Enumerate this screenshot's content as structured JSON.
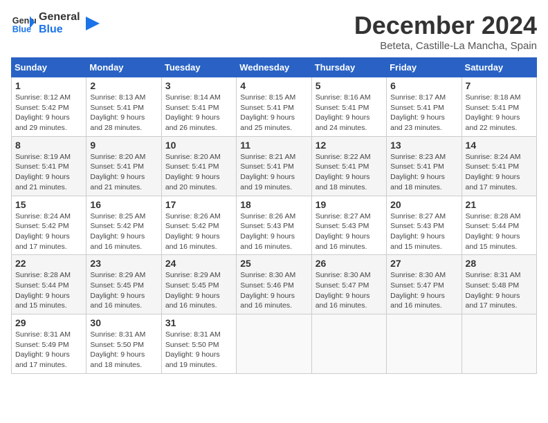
{
  "logo": {
    "line1": "General",
    "line2": "Blue"
  },
  "title": "December 2024",
  "subtitle": "Beteta, Castille-La Mancha, Spain",
  "weekdays": [
    "Sunday",
    "Monday",
    "Tuesday",
    "Wednesday",
    "Thursday",
    "Friday",
    "Saturday"
  ],
  "weeks": [
    [
      {
        "day": "1",
        "sunrise": "8:12 AM",
        "sunset": "5:42 PM",
        "daylight": "9 hours and 29 minutes."
      },
      {
        "day": "2",
        "sunrise": "8:13 AM",
        "sunset": "5:41 PM",
        "daylight": "9 hours and 28 minutes."
      },
      {
        "day": "3",
        "sunrise": "8:14 AM",
        "sunset": "5:41 PM",
        "daylight": "9 hours and 26 minutes."
      },
      {
        "day": "4",
        "sunrise": "8:15 AM",
        "sunset": "5:41 PM",
        "daylight": "9 hours and 25 minutes."
      },
      {
        "day": "5",
        "sunrise": "8:16 AM",
        "sunset": "5:41 PM",
        "daylight": "9 hours and 24 minutes."
      },
      {
        "day": "6",
        "sunrise": "8:17 AM",
        "sunset": "5:41 PM",
        "daylight": "9 hours and 23 minutes."
      },
      {
        "day": "7",
        "sunrise": "8:18 AM",
        "sunset": "5:41 PM",
        "daylight": "9 hours and 22 minutes."
      }
    ],
    [
      {
        "day": "8",
        "sunrise": "8:19 AM",
        "sunset": "5:41 PM",
        "daylight": "9 hours and 21 minutes."
      },
      {
        "day": "9",
        "sunrise": "8:20 AM",
        "sunset": "5:41 PM",
        "daylight": "9 hours and 21 minutes."
      },
      {
        "day": "10",
        "sunrise": "8:20 AM",
        "sunset": "5:41 PM",
        "daylight": "9 hours and 20 minutes."
      },
      {
        "day": "11",
        "sunrise": "8:21 AM",
        "sunset": "5:41 PM",
        "daylight": "9 hours and 19 minutes."
      },
      {
        "day": "12",
        "sunrise": "8:22 AM",
        "sunset": "5:41 PM",
        "daylight": "9 hours and 18 minutes."
      },
      {
        "day": "13",
        "sunrise": "8:23 AM",
        "sunset": "5:41 PM",
        "daylight": "9 hours and 18 minutes."
      },
      {
        "day": "14",
        "sunrise": "8:24 AM",
        "sunset": "5:41 PM",
        "daylight": "9 hours and 17 minutes."
      }
    ],
    [
      {
        "day": "15",
        "sunrise": "8:24 AM",
        "sunset": "5:42 PM",
        "daylight": "9 hours and 17 minutes."
      },
      {
        "day": "16",
        "sunrise": "8:25 AM",
        "sunset": "5:42 PM",
        "daylight": "9 hours and 16 minutes."
      },
      {
        "day": "17",
        "sunrise": "8:26 AM",
        "sunset": "5:42 PM",
        "daylight": "9 hours and 16 minutes."
      },
      {
        "day": "18",
        "sunrise": "8:26 AM",
        "sunset": "5:43 PM",
        "daylight": "9 hours and 16 minutes."
      },
      {
        "day": "19",
        "sunrise": "8:27 AM",
        "sunset": "5:43 PM",
        "daylight": "9 hours and 16 minutes."
      },
      {
        "day": "20",
        "sunrise": "8:27 AM",
        "sunset": "5:43 PM",
        "daylight": "9 hours and 15 minutes."
      },
      {
        "day": "21",
        "sunrise": "8:28 AM",
        "sunset": "5:44 PM",
        "daylight": "9 hours and 15 minutes."
      }
    ],
    [
      {
        "day": "22",
        "sunrise": "8:28 AM",
        "sunset": "5:44 PM",
        "daylight": "9 hours and 15 minutes."
      },
      {
        "day": "23",
        "sunrise": "8:29 AM",
        "sunset": "5:45 PM",
        "daylight": "9 hours and 16 minutes."
      },
      {
        "day": "24",
        "sunrise": "8:29 AM",
        "sunset": "5:45 PM",
        "daylight": "9 hours and 16 minutes."
      },
      {
        "day": "25",
        "sunrise": "8:30 AM",
        "sunset": "5:46 PM",
        "daylight": "9 hours and 16 minutes."
      },
      {
        "day": "26",
        "sunrise": "8:30 AM",
        "sunset": "5:47 PM",
        "daylight": "9 hours and 16 minutes."
      },
      {
        "day": "27",
        "sunrise": "8:30 AM",
        "sunset": "5:47 PM",
        "daylight": "9 hours and 16 minutes."
      },
      {
        "day": "28",
        "sunrise": "8:31 AM",
        "sunset": "5:48 PM",
        "daylight": "9 hours and 17 minutes."
      }
    ],
    [
      {
        "day": "29",
        "sunrise": "8:31 AM",
        "sunset": "5:49 PM",
        "daylight": "9 hours and 17 minutes."
      },
      {
        "day": "30",
        "sunrise": "8:31 AM",
        "sunset": "5:50 PM",
        "daylight": "9 hours and 18 minutes."
      },
      {
        "day": "31",
        "sunrise": "8:31 AM",
        "sunset": "5:50 PM",
        "daylight": "9 hours and 19 minutes."
      },
      null,
      null,
      null,
      null
    ]
  ]
}
